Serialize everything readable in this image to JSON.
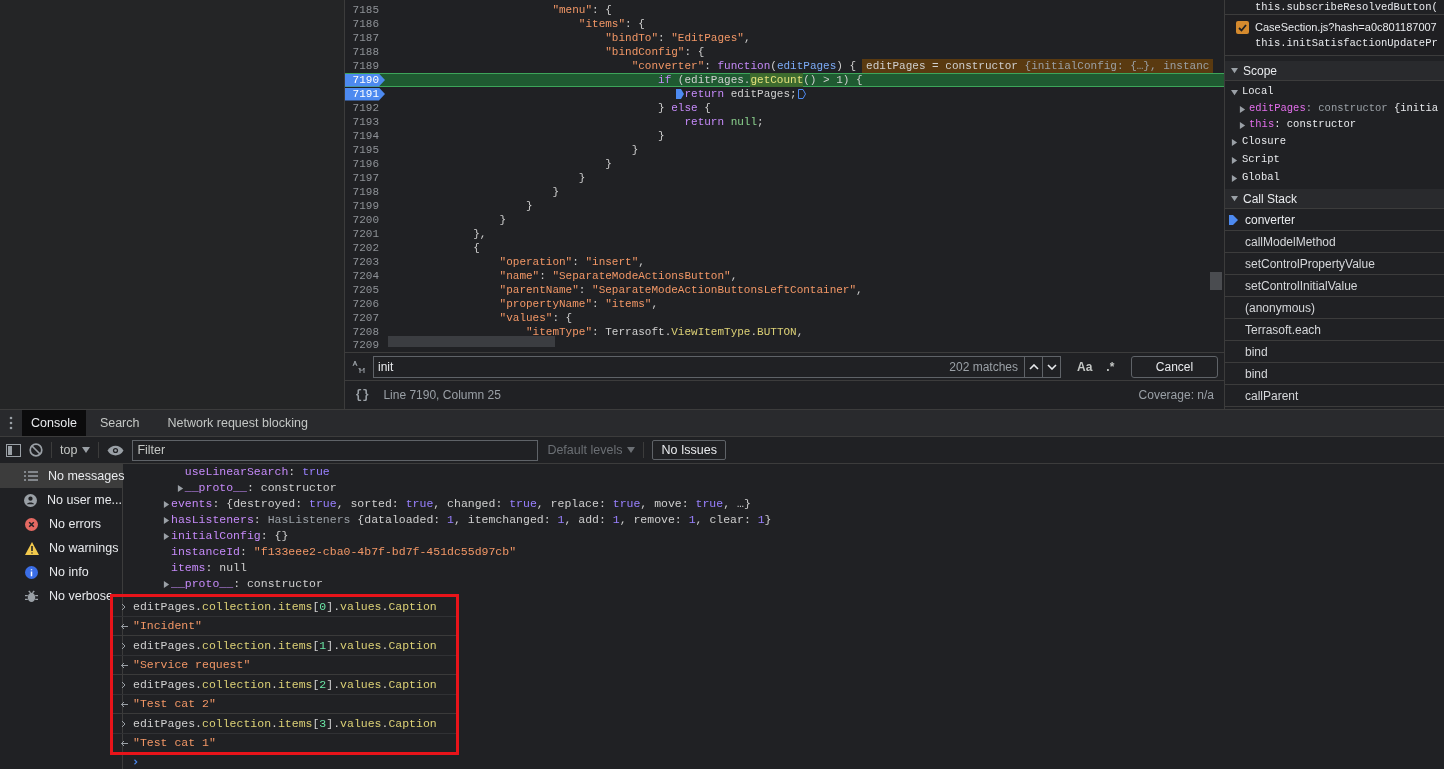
{
  "editor": {
    "lines": [
      {
        "number": "7185",
        "breakpoint": false,
        "current": false,
        "tokens": [
          {
            "text": "                        \"menu\"",
            "kind": "key"
          },
          {
            "text": ": {",
            "kind": "plain"
          }
        ]
      },
      {
        "number": "7186",
        "breakpoint": false,
        "current": false,
        "tokens": [
          {
            "text": "                            \"items\"",
            "kind": "key"
          },
          {
            "text": ": {",
            "kind": "plain"
          }
        ]
      },
      {
        "number": "7187",
        "breakpoint": false,
        "current": false,
        "tokens": [
          {
            "text": "                                \"bindTo\"",
            "kind": "key"
          },
          {
            "text": ": ",
            "kind": "plain"
          },
          {
            "text": "\"EditPages\"",
            "kind": "str"
          },
          {
            "text": ",",
            "kind": "plain"
          }
        ]
      },
      {
        "number": "7188",
        "breakpoint": false,
        "current": false,
        "tokens": [
          {
            "text": "                                \"bindConfig\"",
            "kind": "key"
          },
          {
            "text": ": {",
            "kind": "plain"
          }
        ]
      },
      {
        "number": "7189",
        "breakpoint": false,
        "current": false,
        "tokens": [
          {
            "text": "                                    \"converter\"",
            "kind": "key"
          },
          {
            "text": ": ",
            "kind": "plain"
          },
          {
            "text": "function",
            "kind": "kw"
          },
          {
            "text": "(",
            "kind": "plain"
          },
          {
            "text": "editPages",
            "kind": "var"
          },
          {
            "text": ") {",
            "kind": "plain"
          }
        ],
        "inline_value": [
          {
            "text": "editPages = constructor ",
            "kind": "plain"
          },
          {
            "text": "{initialConfig: {…}, instanc",
            "kind": "dim"
          }
        ]
      },
      {
        "number": "7190",
        "breakpoint": true,
        "current": true,
        "tokens": [
          {
            "text": "                                        if",
            "kind": "kw"
          },
          {
            "text": " (editPages.",
            "kind": "plain"
          },
          {
            "text": "getCount",
            "kind": "hl"
          },
          {
            "text": "() > 1) {",
            "kind": "plain"
          }
        ]
      },
      {
        "number": "7191",
        "breakpoint": true,
        "current": false,
        "inline_breakpoints": true,
        "tokens": [
          {
            "text": "                                            return",
            "kind": "kw"
          },
          {
            "text": " editPages;",
            "kind": "plain"
          }
        ]
      },
      {
        "number": "7192",
        "breakpoint": false,
        "current": false,
        "tokens": [
          {
            "text": "                                        } ",
            "kind": "plain"
          },
          {
            "text": "else",
            "kind": "kw"
          },
          {
            "text": " {",
            "kind": "plain"
          }
        ]
      },
      {
        "number": "7193",
        "breakpoint": false,
        "current": false,
        "tokens": [
          {
            "text": "                                            return",
            "kind": "kw"
          },
          {
            "text": " null",
            "kind": "null"
          },
          {
            "text": ";",
            "kind": "plain"
          }
        ]
      },
      {
        "number": "7194",
        "breakpoint": false,
        "current": false,
        "tokens": [
          {
            "text": "                                        }",
            "kind": "plain"
          }
        ]
      },
      {
        "number": "7195",
        "breakpoint": false,
        "current": false,
        "tokens": [
          {
            "text": "                                    }",
            "kind": "plain"
          }
        ]
      },
      {
        "number": "7196",
        "breakpoint": false,
        "current": false,
        "tokens": [
          {
            "text": "                                }",
            "kind": "plain"
          }
        ]
      },
      {
        "number": "7197",
        "breakpoint": false,
        "current": false,
        "tokens": [
          {
            "text": "                            }",
            "kind": "plain"
          }
        ]
      },
      {
        "number": "7198",
        "breakpoint": false,
        "current": false,
        "tokens": [
          {
            "text": "                        }",
            "kind": "plain"
          }
        ]
      },
      {
        "number": "7199",
        "breakpoint": false,
        "current": false,
        "tokens": [
          {
            "text": "                    }",
            "kind": "plain"
          }
        ]
      },
      {
        "number": "7200",
        "breakpoint": false,
        "current": false,
        "tokens": [
          {
            "text": "                }",
            "kind": "plain"
          }
        ]
      },
      {
        "number": "7201",
        "breakpoint": false,
        "current": false,
        "tokens": [
          {
            "text": "            },",
            "kind": "plain"
          }
        ]
      },
      {
        "number": "7202",
        "breakpoint": false,
        "current": false,
        "tokens": [
          {
            "text": "            {",
            "kind": "plain"
          }
        ]
      },
      {
        "number": "7203",
        "breakpoint": false,
        "current": false,
        "tokens": [
          {
            "text": "                \"operation\"",
            "kind": "key"
          },
          {
            "text": ": ",
            "kind": "plain"
          },
          {
            "text": "\"insert\"",
            "kind": "str"
          },
          {
            "text": ",",
            "kind": "plain"
          }
        ]
      },
      {
        "number": "7204",
        "breakpoint": false,
        "current": false,
        "tokens": [
          {
            "text": "                \"name\"",
            "kind": "key"
          },
          {
            "text": ": ",
            "kind": "plain"
          },
          {
            "text": "\"SeparateModeActionsButton\"",
            "kind": "str"
          },
          {
            "text": ",",
            "kind": "plain"
          }
        ]
      },
      {
        "number": "7205",
        "breakpoint": false,
        "current": false,
        "tokens": [
          {
            "text": "                \"parentName\"",
            "kind": "key"
          },
          {
            "text": ": ",
            "kind": "plain"
          },
          {
            "text": "\"SeparateModeActionButtonsLeftContainer\"",
            "kind": "str"
          },
          {
            "text": ",",
            "kind": "plain"
          }
        ]
      },
      {
        "number": "7206",
        "breakpoint": false,
        "current": false,
        "tokens": [
          {
            "text": "                \"propertyName\"",
            "kind": "key"
          },
          {
            "text": ": ",
            "kind": "plain"
          },
          {
            "text": "\"items\"",
            "kind": "str"
          },
          {
            "text": ",",
            "kind": "plain"
          }
        ]
      },
      {
        "number": "7207",
        "breakpoint": false,
        "current": false,
        "tokens": [
          {
            "text": "                \"values\"",
            "kind": "key"
          },
          {
            "text": ": {",
            "kind": "plain"
          }
        ]
      },
      {
        "number": "7208",
        "breakpoint": false,
        "current": false,
        "tokens": [
          {
            "text": "                    \"itemType\"",
            "kind": "key"
          },
          {
            "text": ": Terrasoft.",
            "kind": "plain"
          },
          {
            "text": "ViewItemType",
            "kind": "prop"
          },
          {
            "text": ".",
            "kind": "plain"
          },
          {
            "text": "BUTTON",
            "kind": "prop"
          },
          {
            "text": ",",
            "kind": "plain"
          }
        ]
      },
      {
        "number": "7209",
        "breakpoint": false,
        "current": false
      }
    ],
    "search": {
      "value": "init",
      "matches": "202 matches",
      "case_label": "Aa",
      "regex_label": ".*",
      "cancel": "Cancel"
    },
    "status": {
      "format": "{}",
      "position": "Line 7190, Column 25",
      "coverage": "Coverage: n/a"
    }
  },
  "debugger": {
    "breakpoints": [
      {
        "file": "this.subscribeResolvedButton("
      },
      {
        "file": "CaseSection.js?hash=a0c801187007",
        "code": "this.initSatisfactionUpdatePr",
        "checked": true
      }
    ],
    "scope": {
      "title": "Scope",
      "expanded": true,
      "groups": [
        {
          "label": "Local",
          "expanded": true,
          "children": [
            {
              "name": "editPages",
              "value": ": constructor ",
              "preview": "{initia",
              "expanded": false
            },
            {
              "name": "this",
              "value": ": constructor",
              "expanded": false
            }
          ]
        },
        {
          "label": "Closure",
          "expanded": false
        },
        {
          "label": "Script",
          "expanded": false
        },
        {
          "label": "Global",
          "expanded": false
        }
      ]
    },
    "call_stack": {
      "title": "Call Stack",
      "expanded": true,
      "frames": [
        {
          "name": "converter",
          "selected": true
        },
        {
          "name": "callModelMethod",
          "selected": false
        },
        {
          "name": "setControlPropertyValue",
          "selected": false
        },
        {
          "name": "setControlInitialValue",
          "selected": false
        },
        {
          "name": "(anonymous)",
          "selected": false
        },
        {
          "name": "Terrasoft.each",
          "selected": false
        },
        {
          "name": "bind",
          "selected": false
        },
        {
          "name": "bind",
          "selected": false
        },
        {
          "name": "callParent",
          "selected": false
        }
      ]
    }
  },
  "drawer": {
    "tabs": [
      {
        "label": "Console",
        "selected": true
      },
      {
        "label": "Search",
        "selected": false
      },
      {
        "label": "Network request blocking",
        "selected": false
      }
    ],
    "toolbar": {
      "context": "top",
      "filter_placeholder": "Filter",
      "levels": "Default levels",
      "issues": "No Issues"
    },
    "sidebar": [
      {
        "label": "No messages",
        "kind": "list",
        "selected": true
      },
      {
        "label": "No user me...",
        "kind": "user",
        "selected": false
      },
      {
        "label": "No errors",
        "kind": "error",
        "selected": false
      },
      {
        "label": "No warnings",
        "kind": "warning",
        "selected": false
      },
      {
        "label": "No info",
        "kind": "info",
        "selected": false
      },
      {
        "label": "No verbose",
        "kind": "verbose",
        "selected": false
      }
    ],
    "output": [
      {
        "children": [
          {
            "tokens": [
              {
                "text": "useLinearSearch",
                "kind": "name"
              },
              {
                "text": ": ",
                "kind": "plain"
              },
              {
                "text": "true",
                "kind": "bool"
              }
            ]
          },
          {
            "expanded": false,
            "tokens": [
              {
                "text": "__proto__",
                "kind": "name"
              },
              {
                "text": ": constructor",
                "kind": "plain"
              }
            ]
          }
        ]
      },
      {
        "expanded": false,
        "tokens": [
          {
            "text": "events",
            "kind": "name"
          },
          {
            "text": ": {destroyed: ",
            "kind": "plain"
          },
          {
            "text": "true",
            "kind": "bool"
          },
          {
            "text": ", sorted: ",
            "kind": "plain"
          },
          {
            "text": "true",
            "kind": "bool"
          },
          {
            "text": ", changed: ",
            "kind": "plain"
          },
          {
            "text": "true",
            "kind": "bool"
          },
          {
            "text": ", replace: ",
            "kind": "plain"
          },
          {
            "text": "true",
            "kind": "bool"
          },
          {
            "text": ", move: ",
            "kind": "plain"
          },
          {
            "text": "true",
            "kind": "bool"
          },
          {
            "text": ", …}",
            "kind": "plain"
          }
        ]
      },
      {
        "expanded": false,
        "tokens": [
          {
            "text": "hasListeners",
            "kind": "name"
          },
          {
            "text": ": ",
            "kind": "plain"
          },
          {
            "text": "HasListeners",
            "kind": "dim"
          },
          {
            "text": " {dataloaded: ",
            "kind": "plain"
          },
          {
            "text": "1",
            "kind": "bool"
          },
          {
            "text": ", itemchanged: ",
            "kind": "plain"
          },
          {
            "text": "1",
            "kind": "bool"
          },
          {
            "text": ", add: ",
            "kind": "plain"
          },
          {
            "text": "1",
            "kind": "bool"
          },
          {
            "text": ", remove: ",
            "kind": "plain"
          },
          {
            "text": "1",
            "kind": "bool"
          },
          {
            "text": ", clear: ",
            "kind": "plain"
          },
          {
            "text": "1",
            "kind": "bool"
          },
          {
            "text": "}",
            "kind": "plain"
          }
        ]
      },
      {
        "expanded": false,
        "tokens": [
          {
            "text": "initialConfig",
            "kind": "name"
          },
          {
            "text": ": {}",
            "kind": "plain"
          }
        ]
      },
      {
        "tokens": [
          {
            "text": "instanceId",
            "kind": "name"
          },
          {
            "text": ": ",
            "kind": "plain"
          },
          {
            "text": "\"f133eee2-cba0-4b7f-bd7f-451dc55d97cb\"",
            "kind": "str"
          }
        ]
      },
      {
        "tokens": [
          {
            "text": "items",
            "kind": "name"
          },
          {
            "text": ": null",
            "kind": "plain"
          }
        ]
      },
      {
        "expanded": false,
        "tokens": [
          {
            "text": "__proto__",
            "kind": "name"
          },
          {
            "text": ": constructor",
            "kind": "plain"
          }
        ]
      }
    ],
    "highlight_frame": true,
    "entries": [
      {
        "input": [
          {
            "text": "editPages.",
            "kind": "plain"
          },
          {
            "text": "collection",
            "kind": "prop"
          },
          {
            "text": ".",
            "kind": "plain"
          },
          {
            "text": "items",
            "kind": "prop"
          },
          {
            "text": "[",
            "kind": "plain"
          },
          {
            "text": "0",
            "kind": "num"
          },
          {
            "text": "].",
            "kind": "plain"
          },
          {
            "text": "values",
            "kind": "prop"
          },
          {
            "text": ".",
            "kind": "plain"
          },
          {
            "text": "Caption",
            "kind": "prop"
          }
        ],
        "result": "\"Incident\""
      },
      {
        "input": [
          {
            "text": "editPages.",
            "kind": "plain"
          },
          {
            "text": "collection",
            "kind": "prop"
          },
          {
            "text": ".",
            "kind": "plain"
          },
          {
            "text": "items",
            "kind": "prop"
          },
          {
            "text": "[",
            "kind": "plain"
          },
          {
            "text": "1",
            "kind": "num"
          },
          {
            "text": "].",
            "kind": "plain"
          },
          {
            "text": "values",
            "kind": "prop"
          },
          {
            "text": ".",
            "kind": "plain"
          },
          {
            "text": "Caption",
            "kind": "prop"
          }
        ],
        "result": "\"Service request\""
      },
      {
        "input": [
          {
            "text": "editPages.",
            "kind": "plain"
          },
          {
            "text": "collection",
            "kind": "prop"
          },
          {
            "text": ".",
            "kind": "plain"
          },
          {
            "text": "items",
            "kind": "prop"
          },
          {
            "text": "[",
            "kind": "plain"
          },
          {
            "text": "2",
            "kind": "num"
          },
          {
            "text": "].",
            "kind": "plain"
          },
          {
            "text": "values",
            "kind": "prop"
          },
          {
            "text": ".",
            "kind": "plain"
          },
          {
            "text": "Caption",
            "kind": "prop"
          }
        ],
        "result": "\"Test cat 2\""
      },
      {
        "input": [
          {
            "text": "editPages.",
            "kind": "plain"
          },
          {
            "text": "collection",
            "kind": "prop"
          },
          {
            "text": ".",
            "kind": "plain"
          },
          {
            "text": "items",
            "kind": "prop"
          },
          {
            "text": "[",
            "kind": "plain"
          },
          {
            "text": "3",
            "kind": "num"
          },
          {
            "text": "].",
            "kind": "plain"
          },
          {
            "text": "values",
            "kind": "prop"
          },
          {
            "text": ".",
            "kind": "plain"
          },
          {
            "text": "Caption",
            "kind": "prop"
          }
        ],
        "result": "\"Test cat 1\""
      }
    ]
  }
}
